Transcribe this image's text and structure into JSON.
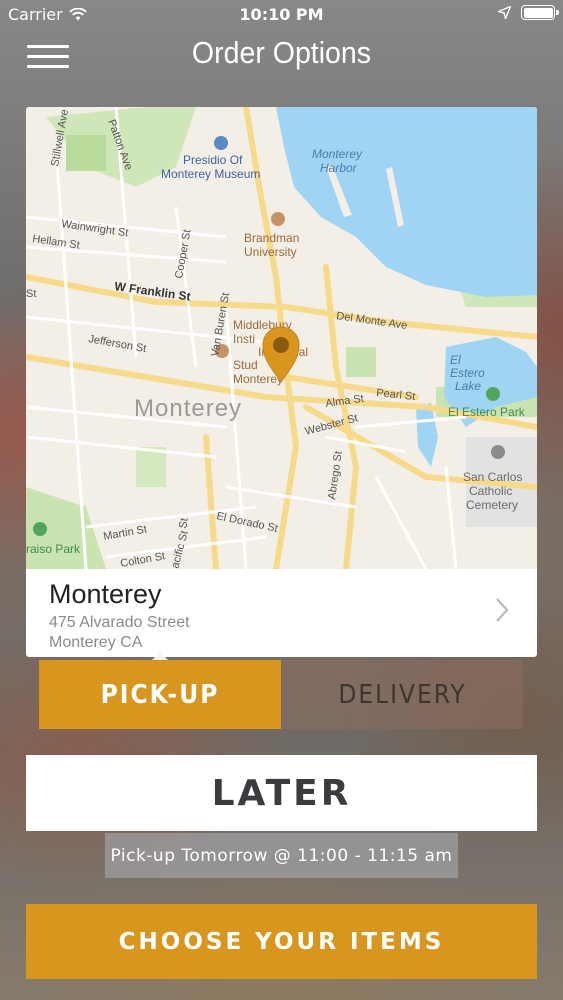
{
  "status_bar": {
    "carrier": "Carrier",
    "time": "10:10 PM",
    "icons": [
      "wifi-icon",
      "location-arrow-icon",
      "battery-icon"
    ]
  },
  "nav": {
    "title": "Order Options",
    "menu_icon": "hamburger-menu-icon"
  },
  "map": {
    "labels": {
      "presidio": "Presidio Of",
      "presidio2": "Monterey Museum",
      "harbor": "Monterey",
      "harbor2": "Harbor",
      "brandman": "Brandman",
      "brandman2": "University",
      "middlebury1": "Middlebury",
      "middlebury2": "Insti",
      "middlebury2b": "Inte",
      "middlebury2c": "nal",
      "middlebury3": "Stud",
      "middlebury3b": "nt",
      "middlebury4": "Monterey",
      "city": "Monterey",
      "estero_lake": "El",
      "estero_lake2": "Estero",
      "estero_lake3": "Lake",
      "estero_park": "El Estero Park",
      "cemetery": "San Carlos",
      "cemetery2": "Catholic",
      "cemetery3": "Cemetery",
      "paraiso": "raiso Park",
      "patton": "Patton Ave",
      "stillwell": "Stillwell Ave",
      "wainwright": "Wainwright St",
      "hellam": "Hellam St",
      "cooper": "Cooper St",
      "franklin": "W Franklin St",
      "delmonte": "Del Monte Ave",
      "vanburen": "Van Buren St",
      "jefferson": "Jefferson St",
      "pearl": "Pearl St",
      "alma": "Alma St",
      "webster": "Webster St",
      "abrego": "Abrego St",
      "martin": "Martin St",
      "eldorado": "El Dorado St",
      "colton": "Colton St",
      "pacific": "acific St",
      "st1": "St",
      "st2": "St"
    },
    "colors": {
      "land": "#f3efe6",
      "water": "#9fd4f2",
      "park": "#c9e4b1",
      "road": "#fbd97a",
      "pin": "#d8961e"
    }
  },
  "location": {
    "name": "Monterey",
    "address_line1": "475 Alvarado Street",
    "address_line2": "Monterey CA"
  },
  "order_type": {
    "pickup_label": "PICK-UP",
    "delivery_label": "DELIVERY",
    "selected": "pickup"
  },
  "timing": {
    "later_label": "LATER",
    "info": "Pick-up Tomorrow @ 11:00 - 11:15 am"
  },
  "cta": {
    "label": "CHOOSE YOUR ITEMS"
  }
}
